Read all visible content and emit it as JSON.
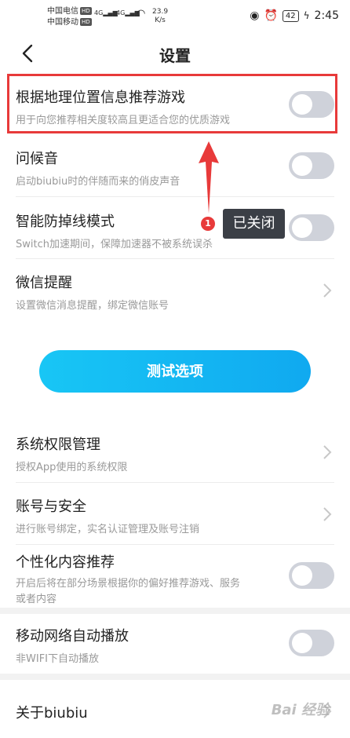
{
  "status_bar": {
    "carrier1": "中国电信",
    "carrier2": "中国移动",
    "hd": "HD",
    "signal1": "4G",
    "signal2": "4G",
    "speed_value": "23.9",
    "speed_unit": "K/s",
    "battery": "42",
    "time": "2:45"
  },
  "header": {
    "title": "设置"
  },
  "rows": {
    "location": {
      "title": "根据地理位置信息推荐游戏",
      "subtitle": "用于向您推荐相关度较高且更适合您的优质游戏",
      "enabled": false
    },
    "greeting": {
      "title": "问候音",
      "subtitle": "启动biubiu时的伴随而来的俏皮声音",
      "enabled": false
    },
    "antidrop": {
      "title": "智能防掉线模式",
      "subtitle": "Switch加速期间，保障加速器不被系统误杀",
      "enabled": false
    },
    "wechat": {
      "title": "微信提醒",
      "subtitle": "设置微信消息提醒，绑定微信账号"
    },
    "permissions": {
      "title": "系统权限管理",
      "subtitle": "授权App使用的系统权限"
    },
    "account": {
      "title": "账号与安全",
      "subtitle": "进行账号绑定，实名认证管理及账号注销"
    },
    "personalized": {
      "title": "个性化内容推荐",
      "subtitle_line1": "开启后将在部分场景根据你的偏好推荐游戏、服务",
      "subtitle_line2": "或者内容",
      "enabled": false
    },
    "autoplay": {
      "title": "移动网络自动播放",
      "subtitle": "非WIFI下自动播放",
      "enabled": false
    },
    "about": {
      "title": "关于biubiu"
    }
  },
  "test_button": {
    "label": "测试选项"
  },
  "annotation": {
    "marker": "1",
    "tooltip": "已关闭"
  },
  "watermark": {
    "text": "Bai 经验"
  },
  "colors": {
    "accent": "#10a9f0",
    "highlight": "#e83a3a",
    "toggle_off": "#cfd2da"
  }
}
